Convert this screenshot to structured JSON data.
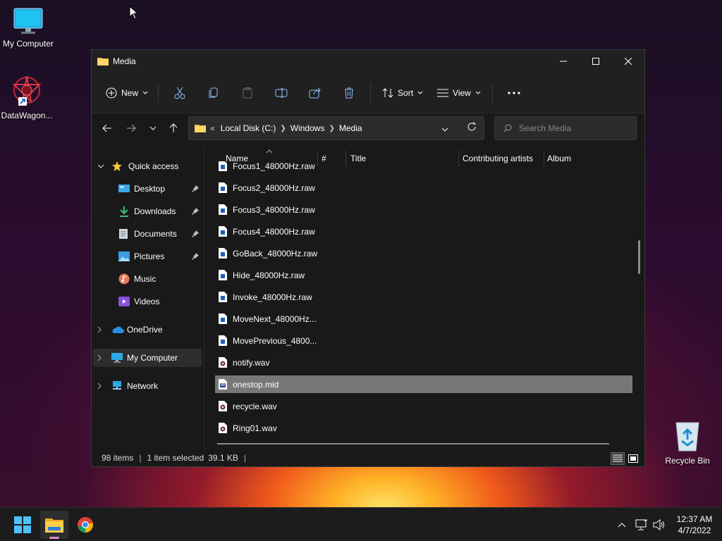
{
  "desktop": {
    "icons": [
      {
        "label": "My Computer",
        "icon": "monitor-icon"
      },
      {
        "label": "DataWagon...",
        "icon": "datawagon-icon"
      },
      {
        "label": "Recycle Bin",
        "icon": "recycle-bin-icon"
      }
    ]
  },
  "window": {
    "title": "Media",
    "controls": {
      "minimize": "minimize-icon",
      "maximize": "maximize-icon",
      "close": "close-icon"
    }
  },
  "toolbar": {
    "new_label": "New",
    "sort_label": "Sort",
    "view_label": "View",
    "icons": [
      "cut-icon",
      "copy-icon",
      "paste-icon",
      "rename-icon",
      "share-icon",
      "delete-icon",
      "more-icon"
    ]
  },
  "address": {
    "overflow": "«",
    "crumbs": [
      "Local Disk (C:)",
      "Windows",
      "Media"
    ]
  },
  "search": {
    "placeholder": "Search Media"
  },
  "nav": {
    "quick_access": "Quick access",
    "items": [
      {
        "label": "Desktop",
        "icon": "desktop-folder-icon",
        "pinned": true
      },
      {
        "label": "Downloads",
        "icon": "downloads-icon",
        "pinned": true
      },
      {
        "label": "Documents",
        "icon": "documents-icon",
        "pinned": true
      },
      {
        "label": "Pictures",
        "icon": "pictures-icon",
        "pinned": true
      },
      {
        "label": "Music",
        "icon": "music-icon",
        "pinned": false
      },
      {
        "label": "Videos",
        "icon": "videos-icon",
        "pinned": false
      }
    ],
    "onedrive": "OneDrive",
    "my_computer": "My Computer",
    "network": "Network"
  },
  "columns": {
    "name": "Name",
    "number": "#",
    "title": "Title",
    "artists": "Contributing artists",
    "album": "Album"
  },
  "files": [
    {
      "name": "Focus1_48000Hz.raw",
      "type": "raw",
      "selected": false
    },
    {
      "name": "Focus2_48000Hz.raw",
      "type": "raw",
      "selected": false
    },
    {
      "name": "Focus3_48000Hz.raw",
      "type": "raw",
      "selected": false
    },
    {
      "name": "Focus4_48000Hz.raw",
      "type": "raw",
      "selected": false
    },
    {
      "name": "GoBack_48000Hz.raw",
      "type": "raw",
      "selected": false
    },
    {
      "name": "Hide_48000Hz.raw",
      "type": "raw",
      "selected": false
    },
    {
      "name": "Invoke_48000Hz.raw",
      "type": "raw",
      "selected": false
    },
    {
      "name": "MoveNext_48000Hz...",
      "type": "raw",
      "selected": false
    },
    {
      "name": "MovePrevious_4800...",
      "type": "raw",
      "selected": false
    },
    {
      "name": "notify.wav",
      "type": "wav",
      "selected": false
    },
    {
      "name": "onestop.mid",
      "type": "mid",
      "selected": true
    },
    {
      "name": "recycle.wav",
      "type": "wav",
      "selected": false
    },
    {
      "name": "Ring01.wav",
      "type": "wav",
      "selected": false
    }
  ],
  "status": {
    "items": "98 items",
    "selection": "1 item selected",
    "size": "39.1 KB"
  },
  "taskbar": {
    "apps": [
      "start-icon",
      "file-explorer-icon",
      "chrome-icon"
    ],
    "tray": [
      "chevron-up-icon",
      "network-icon",
      "volume-icon"
    ],
    "time": "12:37 AM",
    "date": "4/7/2022"
  }
}
